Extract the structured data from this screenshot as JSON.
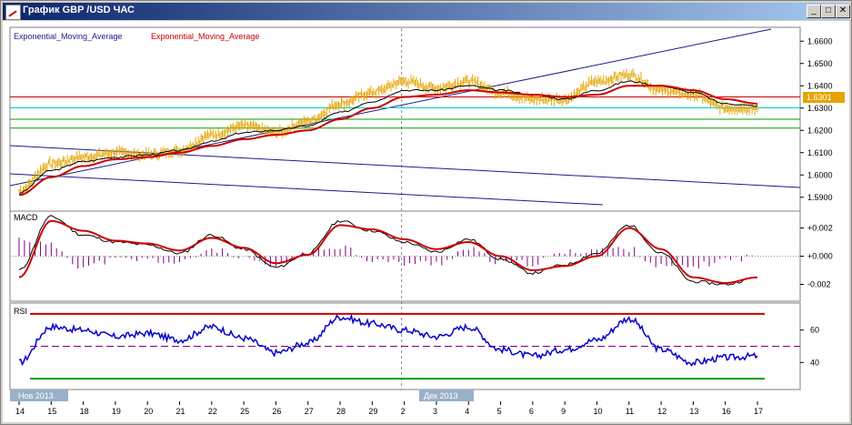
{
  "window": {
    "title": "График GBP /USD ЧАС",
    "minimize_label": "_",
    "maximize_label": "□",
    "close_label": "✕"
  },
  "main_panel": {
    "indicator_labels": [
      "Exponential_Moving_Average",
      "Exponential_Moving_Average"
    ],
    "indicator_colors": [
      "#1a1a8a",
      "#cc0000"
    ],
    "current_price": "1.6301"
  },
  "macd_panel": {
    "label": "MACD"
  },
  "rsi_panel": {
    "label": "RSI"
  },
  "x_axis": {
    "month_labels": [
      "Нов 2013",
      "Дек 2013"
    ],
    "tick_labels": [
      "14",
      "15",
      "18",
      "19",
      "20",
      "21",
      "22",
      "25",
      "26",
      "27",
      "28",
      "29",
      "2",
      "3",
      "4",
      "5",
      "6",
      "9",
      "10",
      "11",
      "12",
      "13",
      "16",
      "17"
    ]
  },
  "colors": {
    "price": "#e6a400",
    "ema_fast": "#000000",
    "ema_slow": "#cc0000",
    "macd_hist": "#800080",
    "rsi_line": "#0000cc",
    "resistance": "#cc0000",
    "support": "#00a000",
    "current_level": "#00cccc",
    "trendline": "#1a1a8a"
  },
  "chart_data": [
    {
      "type": "line",
      "panel": "price",
      "ylim": [
        1.585,
        1.665
      ],
      "y_ticks": [
        "1.6600",
        "1.6500",
        "1.6400",
        "1.6300",
        "1.6200",
        "1.6100",
        "1.6000",
        "1.5900"
      ],
      "categories": [
        "14",
        "15",
        "18",
        "19",
        "20",
        "21",
        "22",
        "25",
        "26",
        "27",
        "28",
        "29",
        "2",
        "3",
        "4",
        "5",
        "6",
        "9",
        "10",
        "11",
        "12",
        "13",
        "16",
        "17"
      ],
      "series": [
        {
          "values": [
            1.593,
            1.605,
            1.608,
            1.61,
            1.609,
            1.611,
            1.618,
            1.622,
            1.619,
            1.624,
            1.632,
            1.637,
            1.642,
            1.639,
            1.642,
            1.637,
            1.634,
            1.634,
            1.642,
            1.645,
            1.638,
            1.636,
            1.63,
            1.63
          ]
        },
        {
          "values": [
            1.592,
            1.602,
            1.606,
            1.608,
            1.609,
            1.611,
            1.615,
            1.619,
            1.62,
            1.622,
            1.628,
            1.633,
            1.638,
            1.638,
            1.64,
            1.638,
            1.636,
            1.634,
            1.638,
            1.642,
            1.64,
            1.637,
            1.632,
            1.631
          ]
        },
        {
          "values": [
            1.591,
            1.599,
            1.604,
            1.607,
            1.608,
            1.61,
            1.613,
            1.616,
            1.618,
            1.62,
            1.625,
            1.63,
            1.635,
            1.636,
            1.638,
            1.637,
            1.636,
            1.635,
            1.636,
            1.64,
            1.64,
            1.638,
            1.634,
            1.632
          ]
        }
      ],
      "horizontal_levels": {
        "resistance": 1.635,
        "current": 1.6301,
        "support_upper": 1.625,
        "support_lower": 1.621
      }
    },
    {
      "type": "line",
      "panel": "macd",
      "y_ticks": [
        "+0.002",
        "+0.000",
        "-0.002"
      ],
      "ylim": [
        -0.003,
        0.003
      ],
      "categories": [
        "14",
        "15",
        "18",
        "19",
        "20",
        "21",
        "22",
        "25",
        "26",
        "27",
        "28",
        "29",
        "2",
        "3",
        "4",
        "5",
        "6",
        "9",
        "10",
        "11",
        "12",
        "13",
        "16",
        "17"
      ],
      "series": [
        {
          "values": [
            -0.001,
            0.0028,
            0.0015,
            0.001,
            0.0008,
            0.0002,
            0.0015,
            0.0005,
            -0.0008,
            0.0002,
            0.0025,
            0.0018,
            0.001,
            0.0003,
            0.0012,
            -0.0002,
            -0.0012,
            -0.0006,
            0.0002,
            0.0022,
            0.0002,
            -0.0018,
            -0.002,
            -0.0015
          ]
        },
        {
          "values": [
            -0.0015,
            0.0025,
            0.0018,
            0.0011,
            0.0009,
            0.0004,
            0.0013,
            0.0006,
            -0.0005,
            0.0001,
            0.0022,
            0.0019,
            0.0012,
            0.0005,
            0.001,
            0.0,
            -0.001,
            -0.0007,
            0.0,
            0.002,
            0.0005,
            -0.0015,
            -0.0019,
            -0.0015
          ]
        }
      ]
    },
    {
      "type": "line",
      "panel": "rsi",
      "ylim": [
        25,
        75
      ],
      "y_ticks": [
        "60",
        "40"
      ],
      "levels": [
        70,
        50,
        30
      ],
      "categories": [
        "14",
        "15",
        "18",
        "19",
        "20",
        "21",
        "22",
        "25",
        "26",
        "27",
        "28",
        "29",
        "2",
        "3",
        "4",
        "5",
        "6",
        "9",
        "10",
        "11",
        "12",
        "13",
        "16",
        "17"
      ],
      "values": [
        40,
        62,
        60,
        56,
        58,
        54,
        62,
        55,
        46,
        52,
        68,
        64,
        60,
        56,
        62,
        48,
        44,
        48,
        54,
        67,
        48,
        40,
        43,
        44
      ]
    }
  ]
}
